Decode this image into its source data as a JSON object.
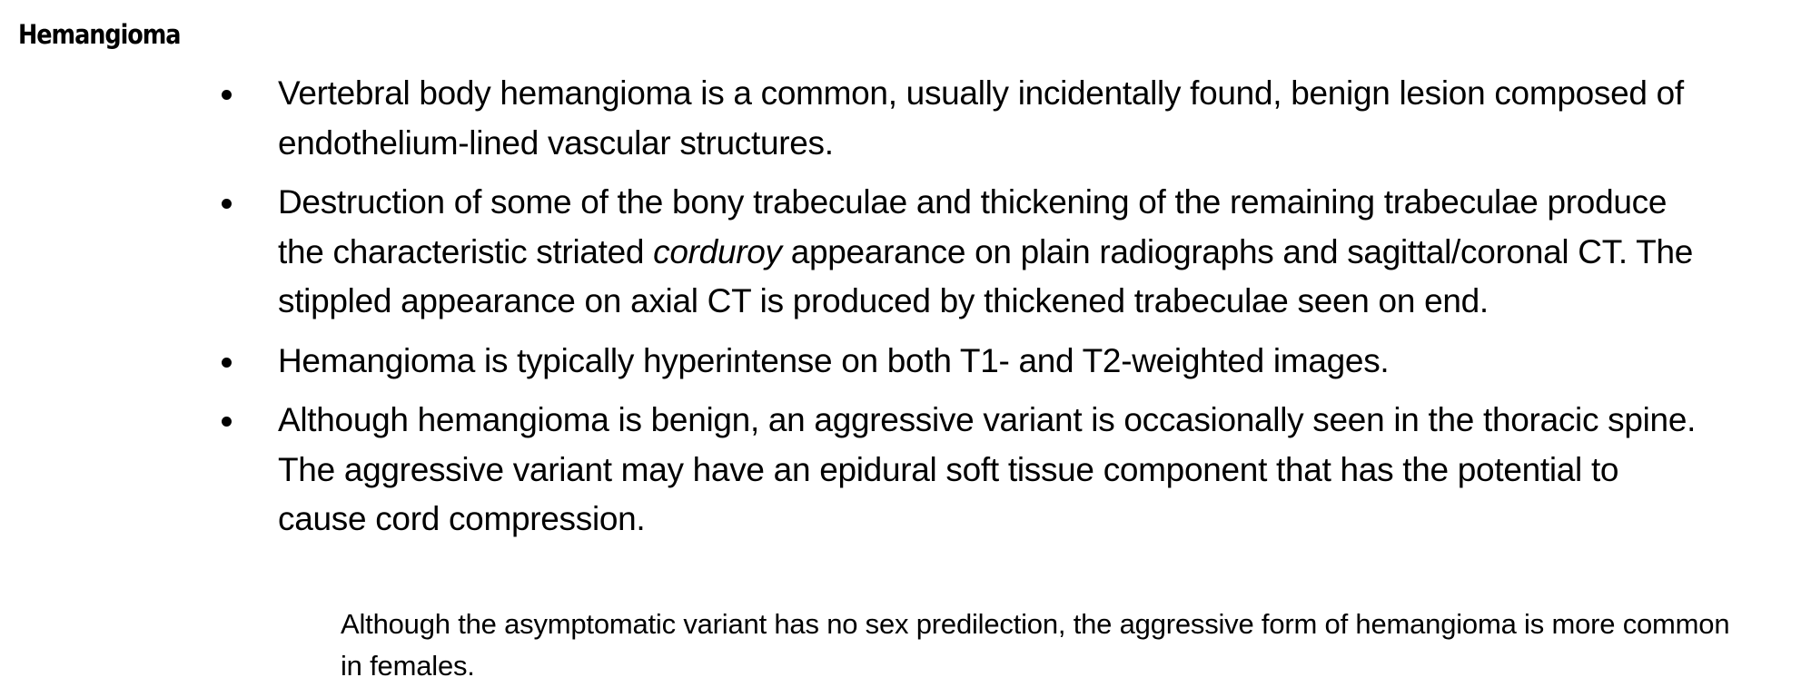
{
  "heading": "Hemangioma",
  "bullets": [
    {
      "text": "Vertebral body hemangioma is a common, usually incidentally found, benign lesion composed of endothelium-lined vascular structures."
    },
    {
      "before": "Destruction of some of the bony trabeculae and thickening of the remaining trabeculae produce the characteristic striated ",
      "emphasis": "corduroy",
      "after": " appearance on plain radiographs and sagittal/coronal CT. The stippled appearance on axial CT is produced by thickened trabeculae seen on end."
    },
    {
      "text": "Hemangioma is typically hyperintense on both T1- and T2-weighted images."
    },
    {
      "text": "Although hemangioma is benign, an aggressive variant is occasionally seen in the thoracic spine. The aggressive variant may have an epidural soft tissue component that has the potential to cause cord compression."
    }
  ],
  "note": "Although the asymptomatic variant has no sex predilection, the aggressive form of hemangioma is more common in females."
}
